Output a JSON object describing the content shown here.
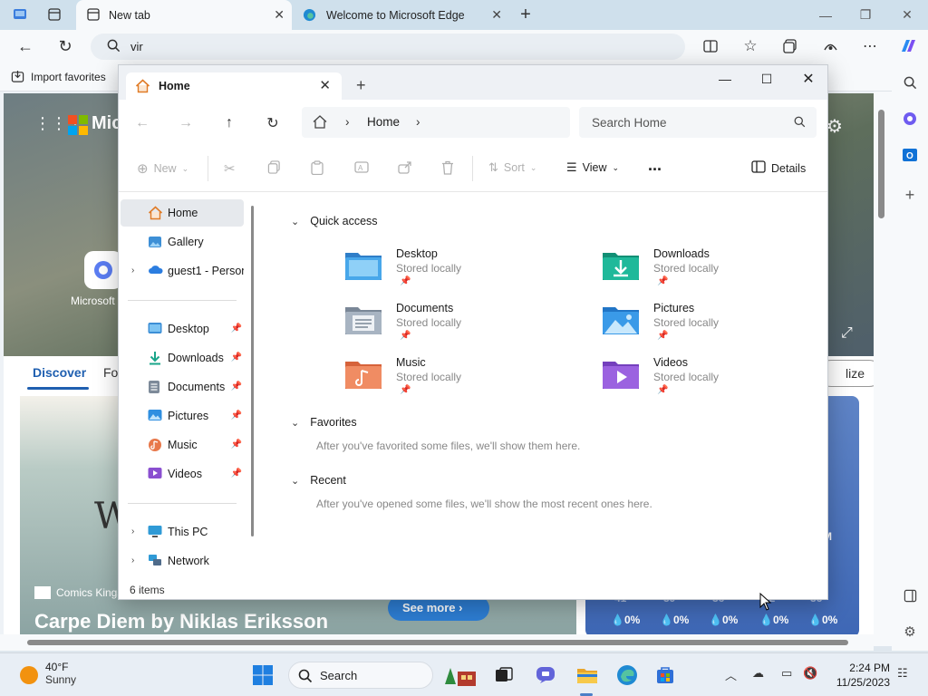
{
  "edge": {
    "tabs": [
      {
        "label": "New tab"
      },
      {
        "label": "Welcome to Microsoft Edge"
      }
    ],
    "address": "vir",
    "favorites_bar": {
      "import_label": "Import favorites"
    }
  },
  "page": {
    "brand_fragment": "Micr",
    "copilot_label": "Microsoft",
    "feed_tab_active": "Discover",
    "feed_tab_next": "Fo",
    "personalize_fragment": "lize",
    "comic": {
      "source": "Comics Kings",
      "title": "Carpe Diem by Niklas Eriksson",
      "letter": "W",
      "see_more": "See more"
    },
    "weather_card": {
      "temps": [
        "41",
        "39",
        "36",
        "32",
        "36"
      ],
      "precip": [
        "0%",
        "0%",
        "0%",
        "0%",
        "0%"
      ],
      "side_letter": "M"
    }
  },
  "explorer": {
    "tab_title": "Home",
    "breadcrumb": "Home",
    "search_placeholder": "Search Home",
    "commands": {
      "new": "New",
      "sort": "Sort",
      "view": "View",
      "more": "...",
      "details": "Details"
    },
    "nav": {
      "top": [
        "Home",
        "Gallery",
        "guest1 - Personal"
      ],
      "pinned": [
        "Desktop",
        "Downloads",
        "Documents",
        "Pictures",
        "Music",
        "Videos"
      ],
      "bottom": [
        "This PC",
        "Network"
      ]
    },
    "status": "6 items",
    "sections": {
      "quick_access": "Quick access",
      "favorites": "Favorites",
      "favorites_empty": "After you've favorited some files, we'll show them here.",
      "recent": "Recent",
      "recent_empty": "After you've opened some files, we'll show the most recent ones here."
    },
    "quick_access_items": [
      {
        "name": "Desktop",
        "sub": "Stored locally"
      },
      {
        "name": "Downloads",
        "sub": "Stored locally"
      },
      {
        "name": "Documents",
        "sub": "Stored locally"
      },
      {
        "name": "Pictures",
        "sub": "Stored locally"
      },
      {
        "name": "Music",
        "sub": "Stored locally"
      },
      {
        "name": "Videos",
        "sub": "Stored locally"
      }
    ]
  },
  "taskbar": {
    "weather_temp": "40°F",
    "weather_cond": "Sunny",
    "search_label": "Search",
    "time": "2:24 PM",
    "date": "11/25/2023"
  },
  "colors": {
    "folder_blue": "#3d8fd6",
    "downloads_teal": "#1aa58a",
    "music_orange": "#e8784a",
    "videos_purple": "#8a4fd0",
    "accent": "#1f5fb0"
  }
}
